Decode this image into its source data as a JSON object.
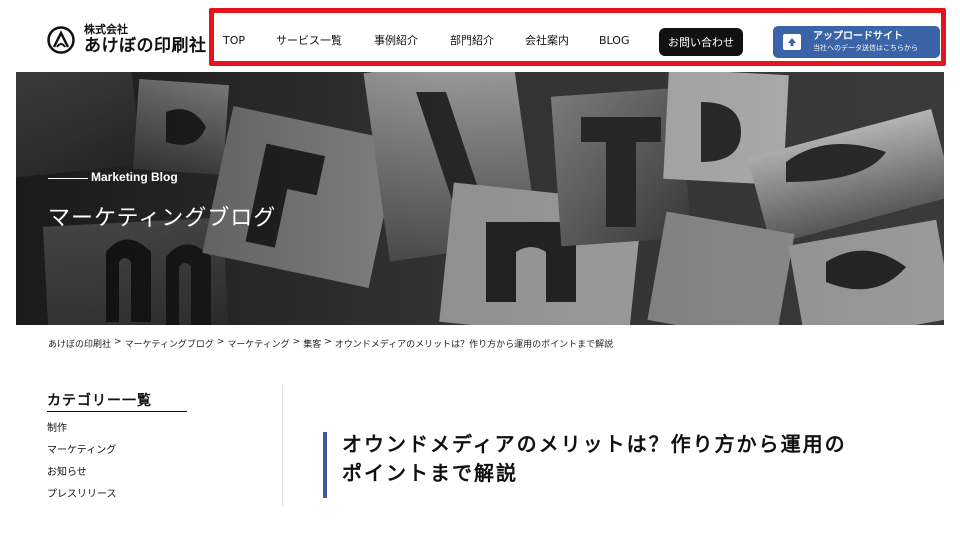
{
  "logo": {
    "small": "株式会社",
    "big": "あけぼの印刷社"
  },
  "nav": {
    "items": [
      "TOP",
      "サービス一覧",
      "事例紹介",
      "部門紹介",
      "会社案内",
      "BLOG"
    ],
    "contact_label": "お問い合わせ",
    "upload": {
      "title": "アップロードサイト",
      "subtitle": "当社へのデータ送信はこちらから"
    }
  },
  "hero": {
    "subtitle": "Marketing Blog",
    "title": "マーケティングブログ"
  },
  "breadcrumb": [
    "あけぼの印刷社",
    "マーケティングブログ",
    "マーケティング",
    "集客",
    "オウンドメディアのメリットは？作り方から運用のポイントまで解説"
  ],
  "sidebar": {
    "title": "カテゴリー一覧",
    "items": [
      "制作",
      "マーケティング",
      "お知らせ",
      "プレスリリース"
    ]
  },
  "article": {
    "title_line1": "オウンドメディアのメリットは？作り方から運用の",
    "title_line2": "ポイントまで解説"
  },
  "colors": {
    "accent": "#3a63a8",
    "highlight_frame": "#e8141c",
    "contact_bg": "#111111"
  }
}
